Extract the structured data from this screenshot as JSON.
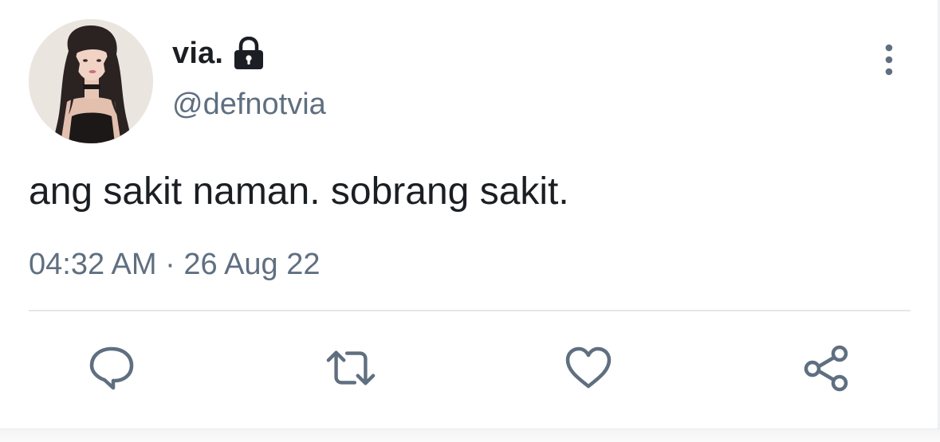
{
  "tweet": {
    "author": {
      "display_name": "via.",
      "handle": "@defnotvia",
      "protected_icon": "lock-icon",
      "avatar": "profile-photo"
    },
    "text": "ang sakit naman. sobrang sakit.",
    "time": "04:32 AM",
    "separator": "·",
    "date": "26 Aug 22",
    "more_icon": "vertical-ellipsis-icon"
  },
  "actions": [
    {
      "name": "reply",
      "icon": "speech-bubble-icon"
    },
    {
      "name": "retweet",
      "icon": "retweet-arrows-icon"
    },
    {
      "name": "like",
      "icon": "heart-icon"
    },
    {
      "name": "share",
      "icon": "share-nodes-icon"
    }
  ],
  "colors": {
    "text_primary": "#1b1f23",
    "text_secondary": "#5f6f80",
    "icon": "#5f6f80",
    "divider": "#e4e7ea",
    "background": "#ffffff"
  }
}
